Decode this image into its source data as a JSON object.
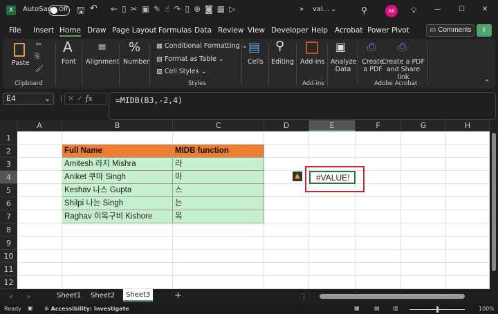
{
  "titlebar": {
    "autosave": "AutoSave",
    "toggle": "Off",
    "filename": "val...",
    "avatar": "AK",
    "more": "»"
  },
  "menu": {
    "tabs": [
      "File",
      "Insert",
      "Home",
      "Draw",
      "Page Layout",
      "Formulas",
      "Data",
      "Review",
      "View",
      "Developer",
      "Help",
      "Acrobat",
      "Power Pivot"
    ],
    "comments": "Comments"
  },
  "ribbon": {
    "paste": "Paste",
    "clipboard": "Clipboard",
    "font": "Font",
    "alignment": "Alignment",
    "number": "Number",
    "cond": "Conditional Formatting",
    "fmt_table": "Format as Table",
    "cell_styles": "Cell Styles",
    "styles": "Styles",
    "cells": "Cells",
    "editing": "Editing",
    "addins": "Add-ins",
    "addins_group": "Add-ins",
    "analyze1": "Analyze",
    "analyze2": "Data",
    "pdf1": "Create",
    "pdf2": "a PDF",
    "share1": "Create a PDF",
    "share2": "and Share link",
    "adobe": "Adobe Acrobat"
  },
  "formula_bar": {
    "name_box": "E4",
    "fx": "fx",
    "formula": "=MIDB(B3,-2,4)"
  },
  "grid": {
    "columns": [
      "A",
      "B",
      "C",
      "D",
      "E",
      "F",
      "G",
      "H"
    ],
    "rows": [
      "1",
      "2",
      "3",
      "4",
      "5",
      "6",
      "7",
      "8",
      "9",
      "10",
      "11",
      "12"
    ],
    "selected": "E4",
    "table": [
      [
        "Full Name",
        "MIDB function"
      ],
      [
        "Amitesh 라지 Mishra",
        "라"
      ],
      [
        "Aniket 쿠마  Singh",
        " 마"
      ],
      [
        "Keshav 나스 Gupta",
        " 스"
      ],
      [
        "Shilpi 나는  Singh",
        " 는"
      ],
      [
        "Raghav 이목구비 Kishore",
        " 목"
      ]
    ],
    "e4": "#VALUE!"
  },
  "sheets": {
    "tabs": [
      "Sheet1",
      "Sheet2",
      "Sheet3"
    ],
    "active": "Sheet3"
  },
  "status": {
    "ready": "Ready",
    "accessibility": "Accessibility: Investigate",
    "zoom": "100%"
  },
  "colors": {
    "header": "#ed7d31",
    "data": "#c6efce",
    "highlight": "#d0202a",
    "accent": "#4fa36b"
  }
}
